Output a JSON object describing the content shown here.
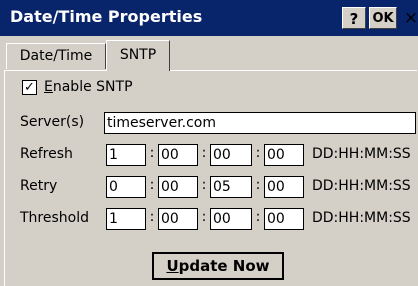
{
  "window": {
    "title": "Date/Time Properties",
    "help_label": "?",
    "ok_label": "OK",
    "close_label": "×"
  },
  "tabs": [
    {
      "label": "Date/Time",
      "active": false
    },
    {
      "label": "SNTP",
      "active": true
    }
  ],
  "sntp": {
    "enable_label_first": "E",
    "enable_label_rest": "nable SNTP",
    "enable_checked": true,
    "check_mark": "✓",
    "server_label": "Server(s)",
    "server_value": "timeserver.com",
    "unit_label": "DD:HH:MM:SS",
    "refresh": {
      "label": "Refresh",
      "values": [
        "1",
        "00",
        "00",
        "00"
      ]
    },
    "retry": {
      "label": "Retry",
      "values": [
        "0",
        "00",
        "05",
        "00"
      ]
    },
    "threshold": {
      "label": "Threshold",
      "values": [
        "1",
        "00",
        "00",
        "00"
      ]
    },
    "update_first": "U",
    "update_rest": "pdate Now"
  }
}
